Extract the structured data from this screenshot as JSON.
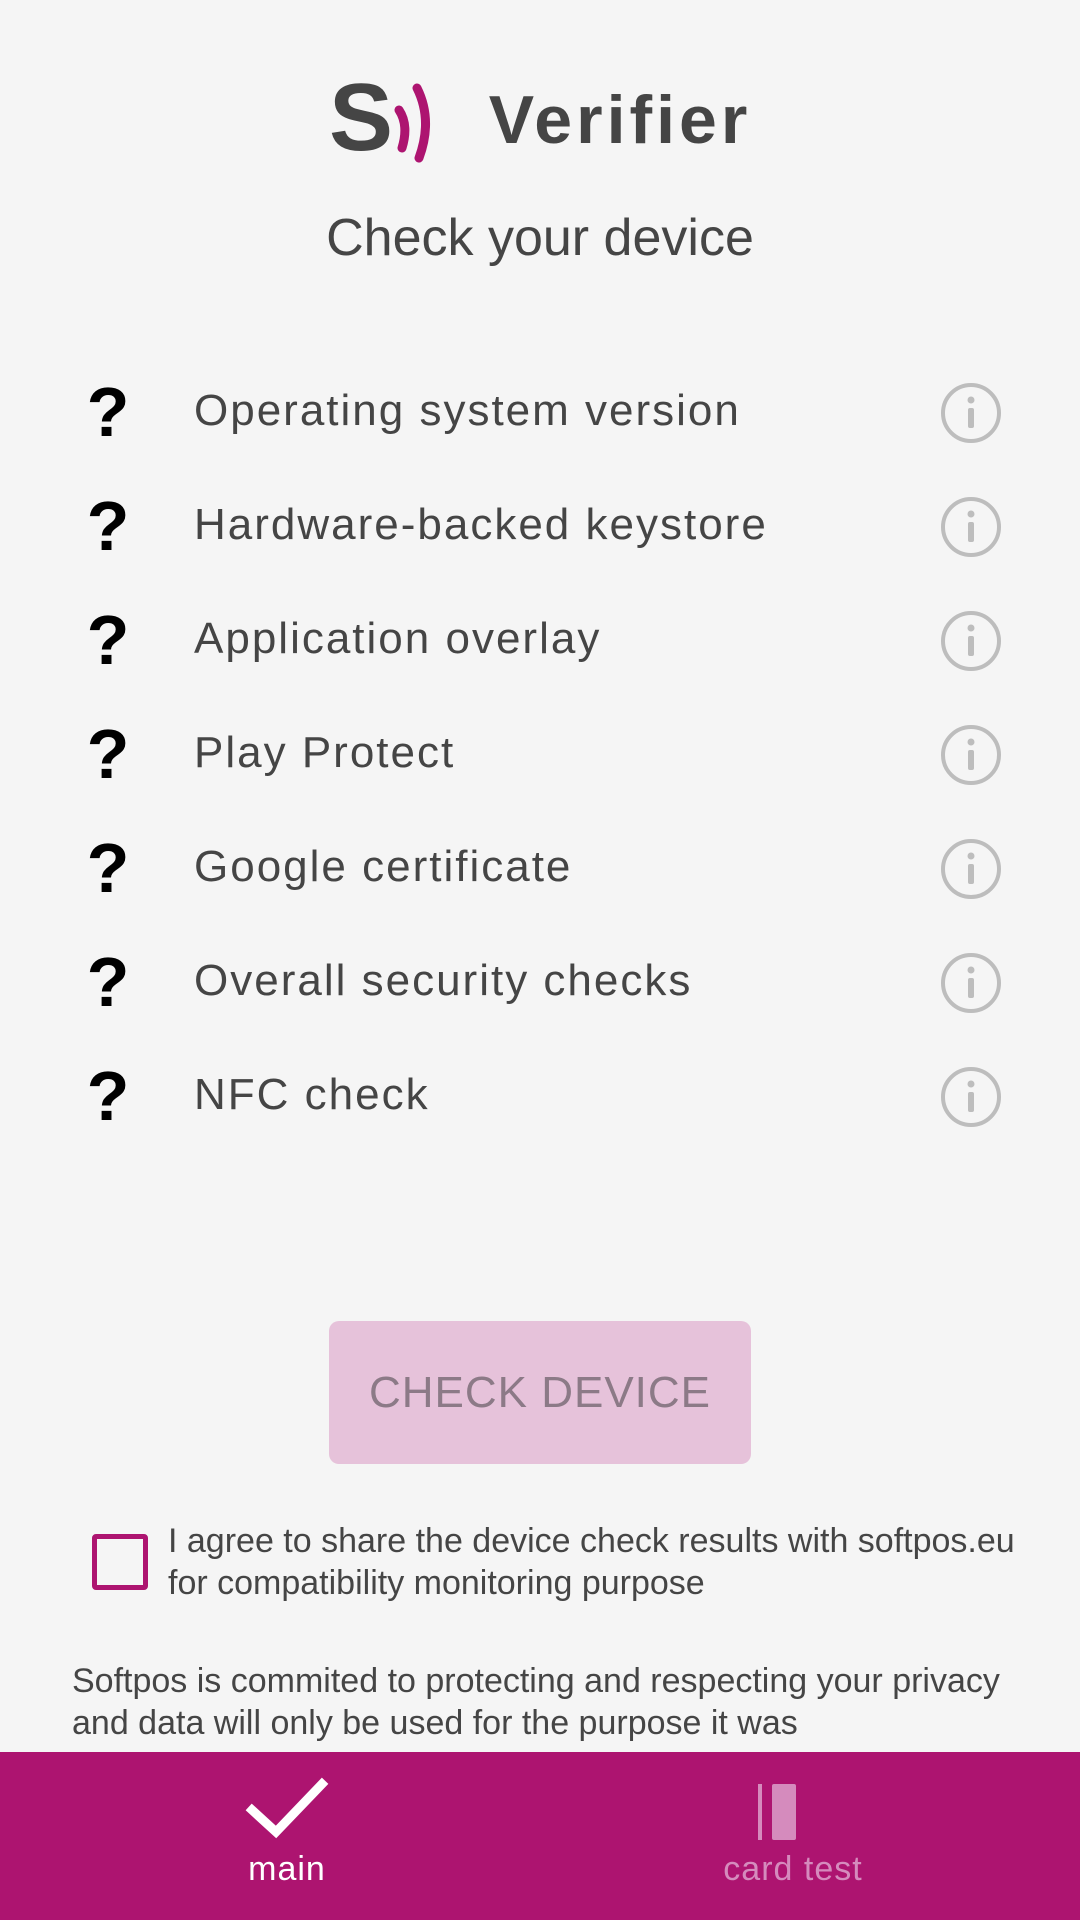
{
  "app": {
    "name": "Verifier",
    "page_title": "Check your device"
  },
  "checks": [
    {
      "label": "Operating system version",
      "status": "?"
    },
    {
      "label": "Hardware-backed keystore",
      "status": "?"
    },
    {
      "label": "Application overlay",
      "status": "?"
    },
    {
      "label": "Play Protect",
      "status": "?"
    },
    {
      "label": "Google certificate",
      "status": "?"
    },
    {
      "label": "Overall security checks",
      "status": "?"
    },
    {
      "label": "NFC check",
      "status": "?"
    }
  ],
  "actions": {
    "check_device_label": "CHECK DEVICE",
    "check_device_enabled": false
  },
  "consent": {
    "text": "I agree to share the device check results with softpos.eu for compatibility monitoring purpose",
    "checked": false
  },
  "privacy_text": "Softpos is commited to protecting and respecting your privacy and data will only be used for the purpose it was",
  "bottom_nav": {
    "items": [
      {
        "label": "main",
        "icon": "checkmark-icon",
        "active": true
      },
      {
        "label": "card test",
        "icon": "card-icon",
        "active": false
      }
    ]
  },
  "colors": {
    "brand": "#ad1470",
    "button_disabled_bg": "#e6c2da",
    "button_disabled_text": "#8c7a87",
    "text": "#454545",
    "info_icon": "#bdbdbd",
    "background": "#f5f5f5"
  }
}
